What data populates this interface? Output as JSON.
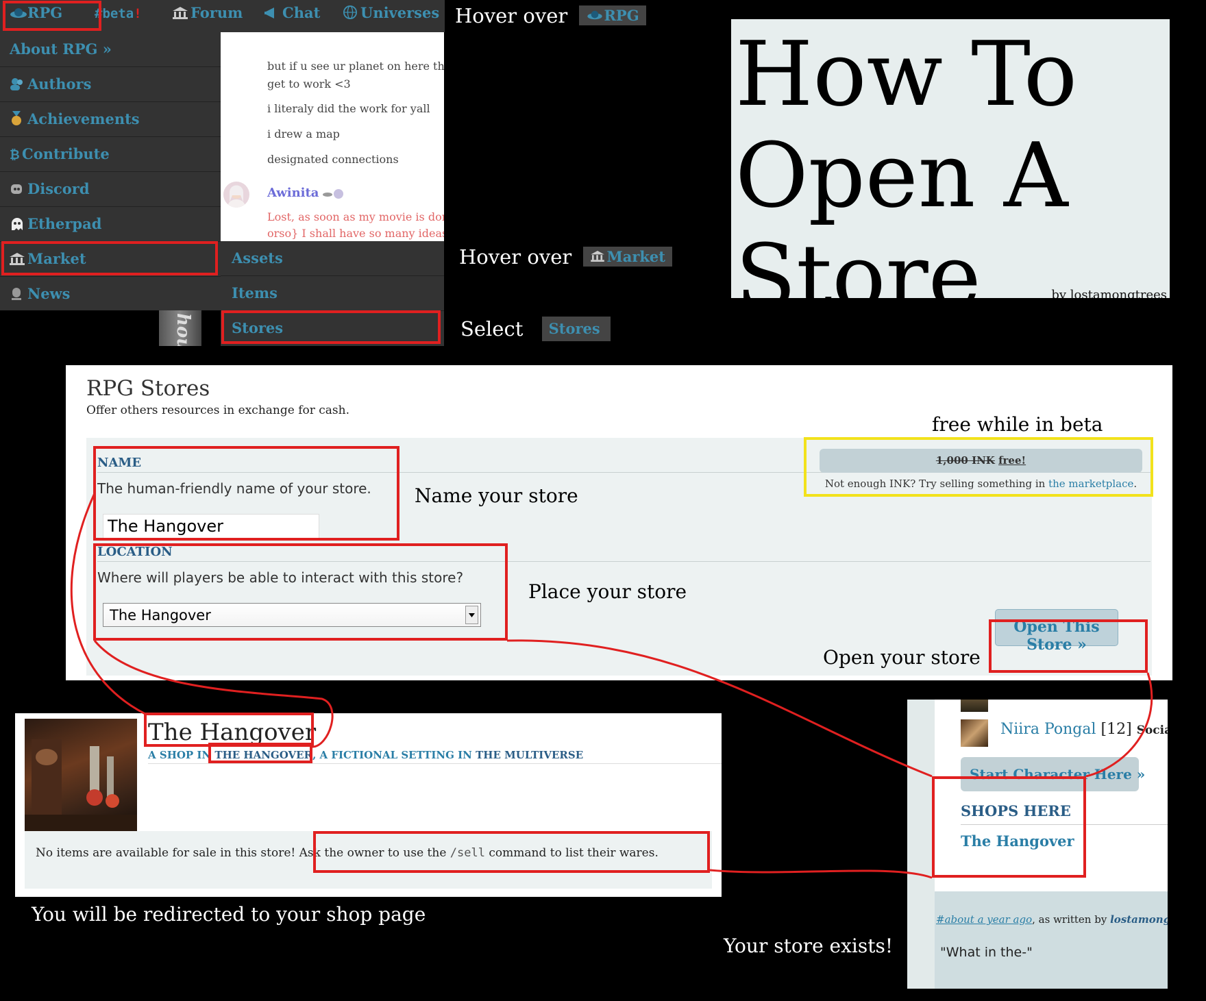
{
  "nav": {
    "rpg": "RPG",
    "beta": "#beta",
    "beta_mark": "!",
    "forum": "Forum",
    "chat": "Chat",
    "universes": "Universes"
  },
  "side_menu": [
    {
      "label": "About RPG »",
      "icon": ""
    },
    {
      "label": "Authors",
      "icon": "users-icon"
    },
    {
      "label": "Achievements",
      "icon": "medal-icon"
    },
    {
      "label": "Contribute",
      "icon": "bitcoin-icon"
    },
    {
      "label": "Discord",
      "icon": "discord-icon"
    },
    {
      "label": "Etherpad",
      "icon": "ghost-icon"
    },
    {
      "label": "Market",
      "icon": "bank-icon"
    },
    {
      "label": "News",
      "icon": "news-icon"
    }
  ],
  "submenu": [
    "Assets",
    "Items",
    "Stores"
  ],
  "chat_preview": {
    "lines": [
      "but if u see ur planet on here th",
      "get to work <3",
      "i literaly did the work for yall",
      "i drew a map",
      "designated connections"
    ],
    "author": "Awinita",
    "author_lines": [
      "Lost, as soon as my movie is don",
      "orso} I shall have so many ideas"
    ],
    "peek": "hou"
  },
  "instructions": {
    "hover_over": "Hover over",
    "rpg_chip": "RPG",
    "hover_market": "Hover over",
    "market_chip": "Market",
    "select": "Select",
    "stores_chip": "Stores"
  },
  "title_card": {
    "title": "How To Open A Store",
    "byline": "by lostamongtrees"
  },
  "stores_form": {
    "heading": "RPG Stores",
    "subheading": "Offer others resources in exchange for cash.",
    "name_label": "NAME",
    "name_hint": "The human-friendly name of your store.",
    "name_value": "The Hangover",
    "location_label": "LOCATION",
    "location_hint": "Where will players be able to interact with this store?",
    "location_value": "The Hangover",
    "price_old": "1,000 INK",
    "price_free": "free!",
    "ink_note": "Not enough INK? Try selling something in",
    "ink_link": "the marketplace",
    "ink_period": ".",
    "open_button": "Open This Store »"
  },
  "annotations": {
    "free_while_beta": "free while in beta",
    "name_your_store": "Name your store",
    "place_your_store": "Place your store",
    "open_your_store": "Open your store",
    "redirected": "You will be redirected to your shop page",
    "store_exists": "Your store exists!"
  },
  "shop_page": {
    "title": "The Hangover",
    "sub_prefix": "A SHOP IN",
    "sub_place": "THE HANGOVER",
    "sub_mid": ", A FICTIONAL SETTING IN",
    "sub_universe": "THE MULTIVERSE",
    "empty_notice_a": "No items are available for sale in this store!",
    "empty_notice_b": "Ask the owner to use the",
    "empty_notice_cmd": "/sell",
    "empty_notice_c": "command to list their wares."
  },
  "side_panel": {
    "character_name": "Niira Pongal",
    "character_level": "[12]",
    "character_tag": "Socialit",
    "start_button": "Start Character Here »",
    "shops_heading": "SHOPS HERE",
    "shop_link": "The Hangover",
    "timestamp": "#about a year ago",
    "written_by": ", as written by",
    "author": "lostamong",
    "quote": "\"What in the-\""
  },
  "colors": {
    "link": "#3d8fb0",
    "nav_bg": "#333333",
    "highlight_red": "#e02020",
    "highlight_yellow": "#f2e21c",
    "form_bg": "#edf2f2"
  }
}
